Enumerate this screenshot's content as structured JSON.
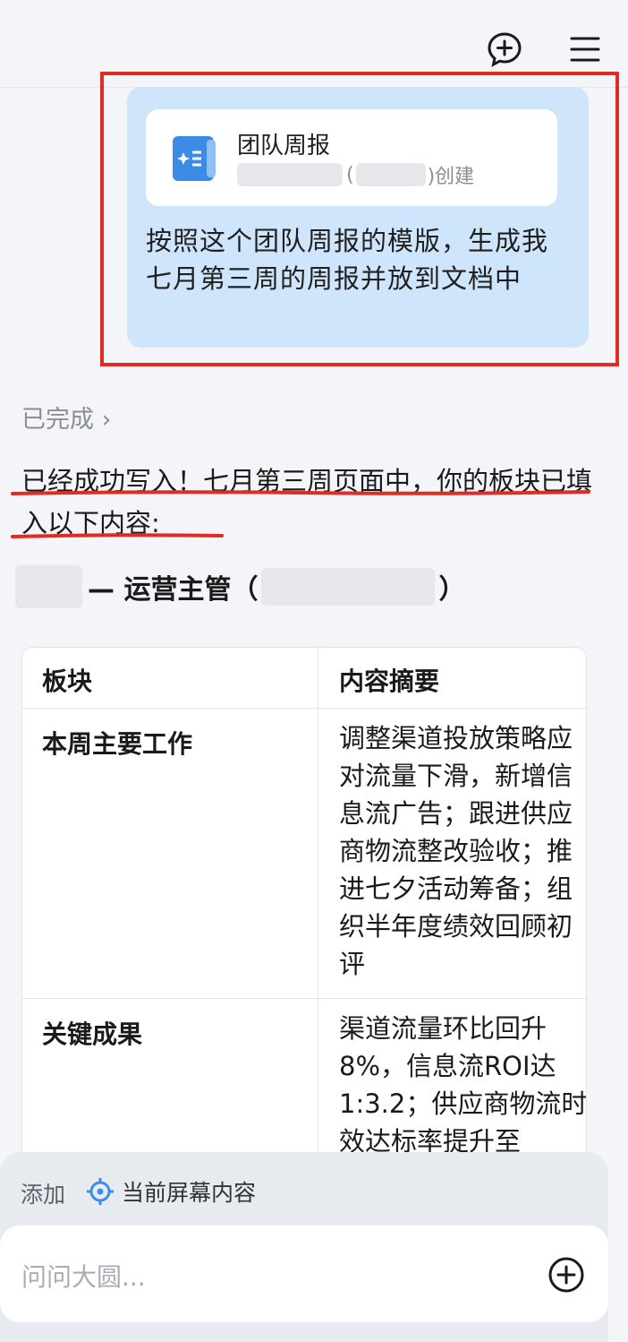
{
  "header": {
    "new_chat_icon": "add-chat-icon",
    "menu_icon": "menu-icon"
  },
  "user_message": {
    "doc_card": {
      "title": "团队周报",
      "paren_open": "(",
      "created_suffix": ")创建"
    },
    "text": "按照这个团队周报的模版，生成我七月第三周的周报并放到文档中"
  },
  "reply": {
    "status": "已完成 ›",
    "intro": "已经成功写入！七月第三周页面中，你的板块已填入以下内容:",
    "person_title": "— 运营主管（",
    "person_close": "）",
    "table": {
      "headers": [
        "板块",
        "内容摘要"
      ],
      "rows": [
        {
          "label": "本周主要工作",
          "text": "调整渠道投放策略应对流量下滑，新增信息流广告；跟进供应商物流整改验收；推进七夕活动筹备；组织半年度绩效回顾初评"
        },
        {
          "label": "关键成果",
          "text": "渠道流量环比回升8%，信息流ROI达1:3.2；供应商物流时效达标率提升至"
        }
      ]
    }
  },
  "composer": {
    "add_label": "添加",
    "screen_chip": "当前屏幕内容",
    "placeholder": "问问大圆...",
    "accent_color": "#3a8ee6",
    "highlight_color": "#e22b22"
  }
}
